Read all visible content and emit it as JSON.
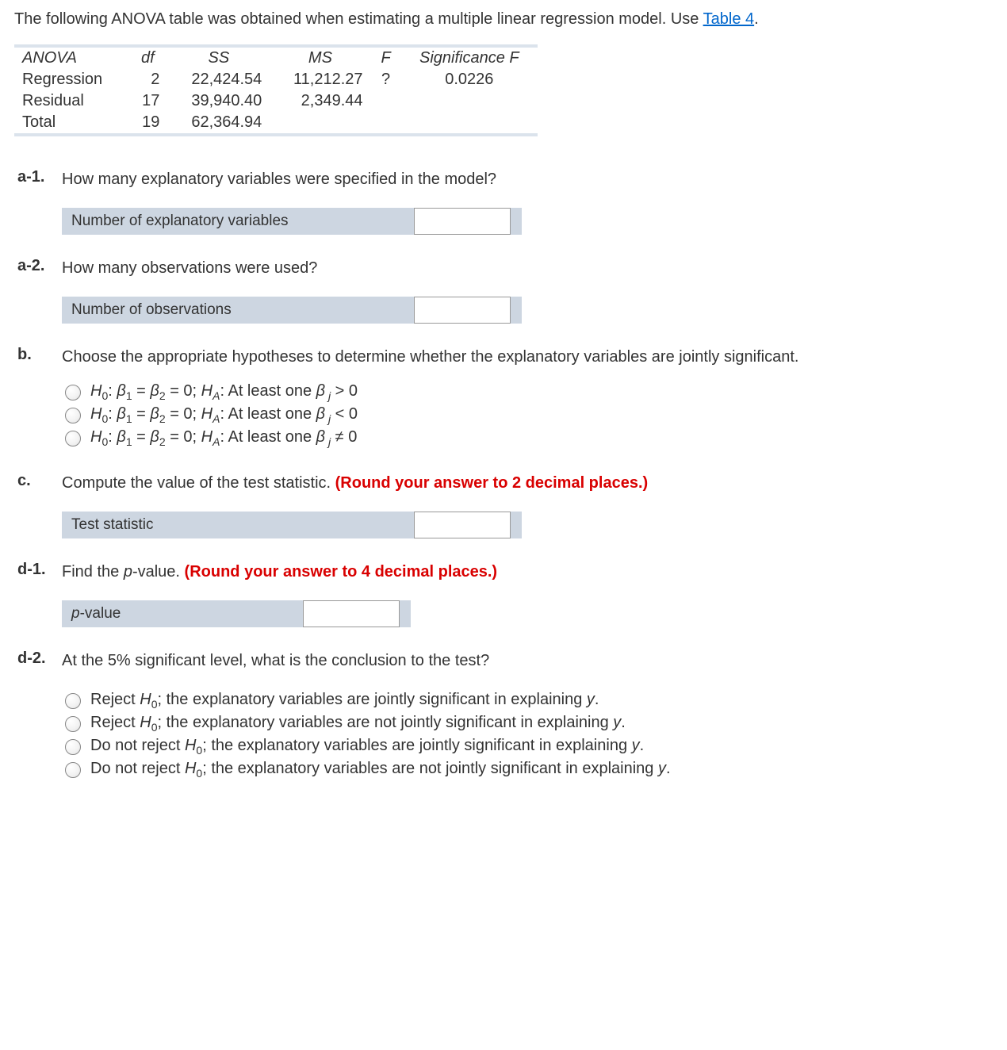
{
  "intro": {
    "text_before_link": "The following ANOVA table was obtained when estimating a multiple linear regression model. Use ",
    "link_text": "Table 4",
    "text_after_link": "."
  },
  "anova": {
    "headers": {
      "col0": "ANOVA",
      "df": "df",
      "ss": "SS",
      "ms": "MS",
      "f": "F",
      "sigf": "Significance F"
    },
    "rows": [
      {
        "label": "Regression",
        "df": "2",
        "ss": "22,424.54",
        "ms": "11,212.27",
        "f": "?",
        "sigf": "0.0226"
      },
      {
        "label": "Residual",
        "df": "17",
        "ss": "39,940.40",
        "ms": "2,349.44",
        "f": "",
        "sigf": ""
      },
      {
        "label": "Total",
        "df": "19",
        "ss": "62,364.94",
        "ms": "",
        "f": "",
        "sigf": ""
      }
    ]
  },
  "questions": {
    "a1": {
      "marker": "a-1.",
      "text": "How many explanatory variables were specified in the model?",
      "label": "Number of explanatory variables"
    },
    "a2": {
      "marker": "a-2.",
      "text": "How many observations were used?",
      "label": "Number of observations"
    },
    "b": {
      "marker": "b.",
      "text": "Choose the appropriate hypotheses to determine whether the explanatory variables are jointly significant.",
      "choices": {
        "c1": {
          "op": ">"
        },
        "c2": {
          "op": "<"
        },
        "c3": {
          "op": "≠"
        }
      }
    },
    "c": {
      "marker": "c.",
      "text_plain": "Compute the value of the test statistic. ",
      "text_red": "(Round your answer to 2 decimal places.)",
      "label": "Test statistic"
    },
    "d1": {
      "marker": "d-1.",
      "text_before": "Find the ",
      "p": "p",
      "text_after": "-value. ",
      "text_red": "(Round your answer to 4 decimal places.)",
      "label_p": "p",
      "label_rest": "-value"
    },
    "d2": {
      "marker": "d-2.",
      "text": "At the 5% significant level, what is the conclusion to the test?",
      "choices": {
        "c1": {
          "prefix": "Reject ",
          "suffix": "; the explanatory variables are jointly significant in explaining ",
          "dv": "y",
          "end": "."
        },
        "c2": {
          "prefix": "Reject ",
          "suffix": "; the explanatory variables are not jointly significant in explaining ",
          "dv": "y",
          "end": "."
        },
        "c3": {
          "prefix": "Do not reject ",
          "suffix": "; the explanatory variables are jointly significant in explaining ",
          "dv": "y",
          "end": "."
        },
        "c4": {
          "prefix": "Do not reject ",
          "suffix": "; the explanatory variables are not jointly significant in explaining ",
          "dv": "y",
          "end": "."
        }
      }
    }
  }
}
